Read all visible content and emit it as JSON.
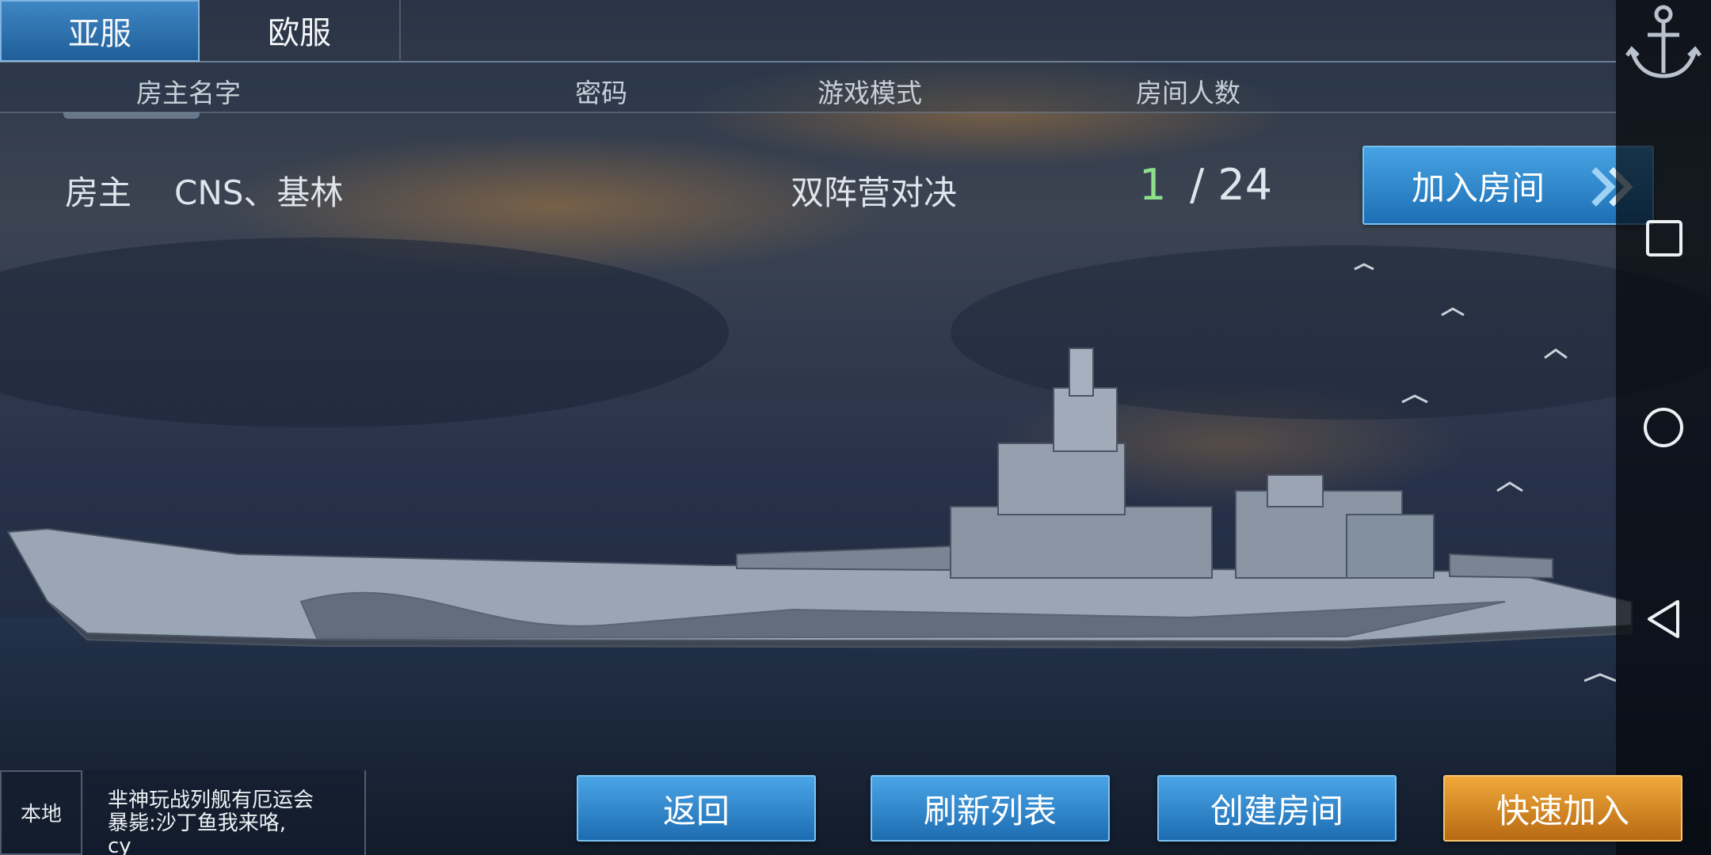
{
  "server_tabs": [
    {
      "label": "亚服",
      "active": true
    },
    {
      "label": "欧服",
      "active": false
    }
  ],
  "columns": {
    "host": "房主名字",
    "password": "密码",
    "mode": "游戏模式",
    "players": "房间人数"
  },
  "rooms": [
    {
      "host_prefix": "房主",
      "host_name": "CNS、基林",
      "mode": "双阵营对决",
      "players_current": "1",
      "players_max": "/ 24",
      "join_label": "加入房间"
    }
  ],
  "chat": {
    "channel_label": "本地",
    "lines": [
      "芈神玩战列舰有厄运会",
      "暴毙:沙丁鱼我来咯,",
      "cy"
    ]
  },
  "buttons": {
    "back": "返回",
    "refresh": "刷新列表",
    "create": "创建房间",
    "quick_join": "快速加入"
  },
  "icons": {
    "logo": "anchor-icon",
    "nav_recent": "recent-apps-icon",
    "nav_home": "home-icon",
    "nav_back": "back-triangle-icon",
    "join_arrow": "double-chevron-icon"
  },
  "colors": {
    "accent_blue": "#2b86cf",
    "accent_gold": "#e08f22",
    "player_count_green": "#8fe08a"
  }
}
